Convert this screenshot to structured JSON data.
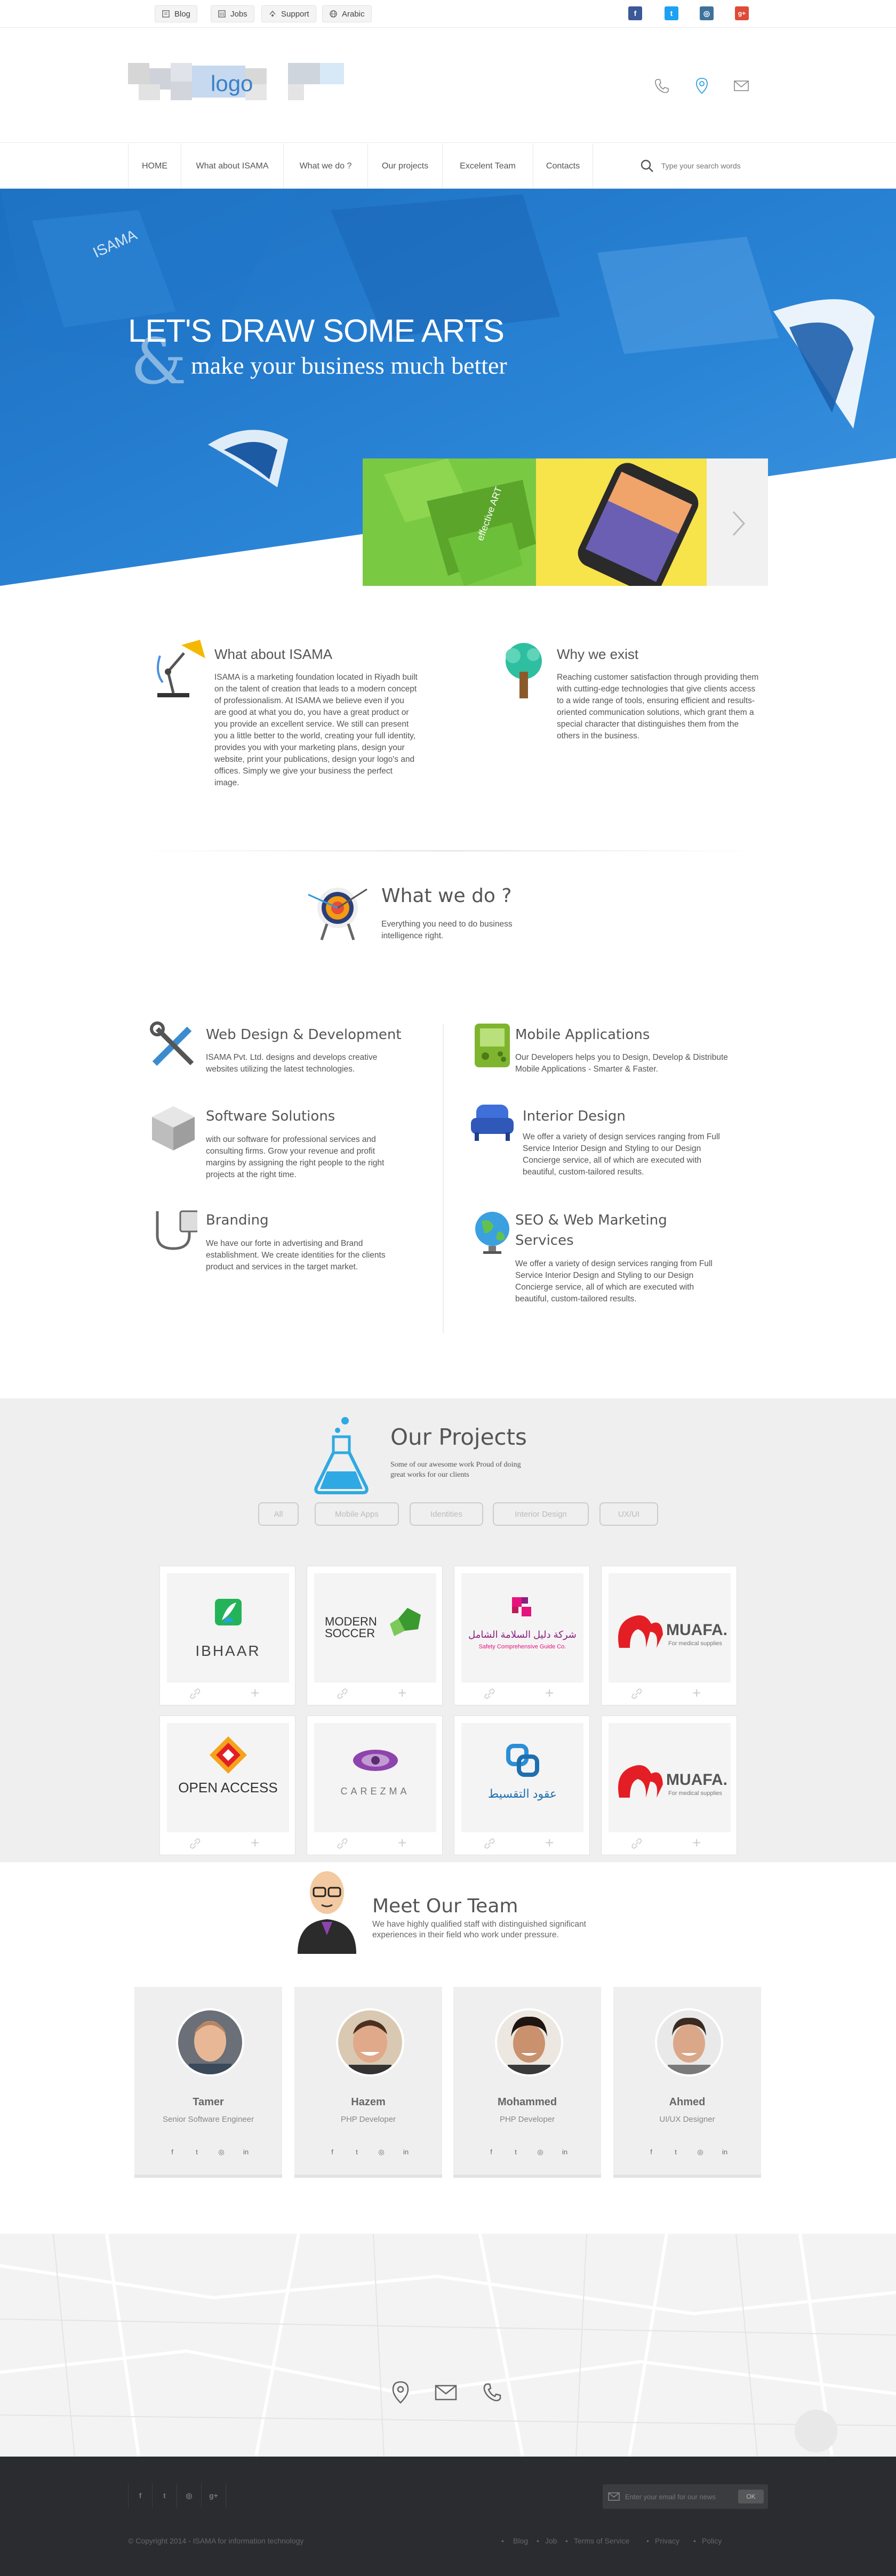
{
  "topbar": {
    "links": [
      {
        "label": "Blog",
        "icon": "blog-icon"
      },
      {
        "label": "Jobs",
        "icon": "jobs-icon"
      },
      {
        "label": "Support",
        "icon": "support-icon"
      },
      {
        "label": "Arabic",
        "icon": "globe-icon"
      }
    ],
    "social": [
      {
        "name": "facebook-icon",
        "glyph": "f",
        "color": "#3b5998"
      },
      {
        "name": "twitter-icon",
        "glyph": "t",
        "color": "#1da1f2"
      },
      {
        "name": "instagram-icon",
        "glyph": "◎",
        "color": "#3f729b"
      },
      {
        "name": "google-plus-icon",
        "glyph": "g+",
        "color": "#dd4b39"
      }
    ]
  },
  "header": {
    "logo_text": "logo",
    "icons": [
      "phone-icon",
      "location-pin-icon",
      "mail-icon"
    ]
  },
  "nav": {
    "items": [
      "HOME",
      "What about ISAMA",
      "What we do ?",
      "Our projects",
      "Excelent Team",
      "Contacts"
    ],
    "search_placeholder": "Type your search words"
  },
  "hero": {
    "title": "LET'S DRAW SOME ARTS",
    "amp": "&",
    "subtitle": "make your business much better",
    "slide_text": "effective ART",
    "accent": "#1e7ccc"
  },
  "about": {
    "left": {
      "title": "What about ISAMA",
      "text": "ISAMA is a marketing foundation located in Riyadh built on the talent of creation that leads to a modern concept of professionalism. At ISAMA we believe even if you are good at what you do, you have a great product or you provide an excellent service. We still can present you a little better to the world, creating your full identity, provides you with your marketing plans, design your website, print your publications, design your logo's and offices. Simply we give your business the perfect image."
    },
    "right": {
      "title": "Why we exist",
      "text": "Reaching customer satisfaction through providing them with cutting-edge technologies that give clients access to a wide range of tools, ensuring efficient and results-oriented communication solutions, which grant them a special character that distinguishes them from the others in the business."
    }
  },
  "whatwedo": {
    "title": "What we do ?",
    "subtitle": "Everything you need to do business intelligence right."
  },
  "services": {
    "left": [
      {
        "title": "Web Design & Development",
        "text": "ISAMA Pvt. Ltd. designs and develops creative websites utilizing the latest technologies."
      },
      {
        "title": "Software Solutions",
        "text": "with our software for professional services and consulting firms. Grow your revenue and profit margins by assigning the right people to the right projects at the right time."
      },
      {
        "title": "Branding",
        "text": "We have our forte in advertising and Brand establishment. We create identities for the clients product and services in the target market."
      }
    ],
    "right": [
      {
        "title": "Mobile Applications",
        "text": "Our Developers helps you to Design, Develop & Distribute Mobile Applications - Smarter & Faster."
      },
      {
        "title": "Interior Design",
        "text": "We offer a variety of design services ranging from Full Service Interior Design and Styling to our Design Concierge service, all of which are executed with beautiful, custom-tailored results."
      },
      {
        "title": "SEO & Web Marketing Services",
        "text": "We offer a variety of design services ranging from Full Service Interior Design and Styling to our Design Concierge service, all of which are executed with beautiful, custom-tailored results."
      }
    ]
  },
  "projects": {
    "title": "Our Projects",
    "subtitle": "Some of our awesome work Proud of doing great works for our clients",
    "filters": [
      "All",
      "Mobile Apps",
      "Identities",
      "Interior Design",
      "UX/UI"
    ],
    "items": [
      {
        "name": "IBHAAR"
      },
      {
        "name": "MODERN SOCCER"
      },
      {
        "name": "شركة دليل السلامة الشامل",
        "sub": "Safety Comprehensive Guide Co."
      },
      {
        "name": "MUAFA.",
        "sub": "For medical supplies"
      },
      {
        "name": "OPEN ACCESS"
      },
      {
        "name": "CAREZMA"
      },
      {
        "name": "عقود التقسيط"
      },
      {
        "name": "MUAFA.",
        "sub": "For medical supplies"
      }
    ]
  },
  "team": {
    "title": "Meet Our Team",
    "subtitle": "We have highly qualified staff with distinguished significant experiences in their field who work under pressure.",
    "members": [
      {
        "name": "Tamer",
        "role": "Senior Software Engineer"
      },
      {
        "name": "Hazem",
        "role": "PHP Developer"
      },
      {
        "name": "Mohammed",
        "role": "PHP Developer"
      },
      {
        "name": "Ahmed",
        "role": "UI/UX Designer"
      }
    ],
    "social_glyphs": [
      "f",
      "t",
      "◎",
      "in"
    ]
  },
  "footer": {
    "social": [
      "f",
      "t",
      "◎",
      "g+"
    ],
    "newsletter_placeholder": "Enter your email for our news",
    "newsletter_button": "OK",
    "copyright": "© Copyright 2014 - ISAMA for information technology",
    "links": [
      "Blog",
      "Job",
      "Terms of Service",
      "Privacy",
      "Policy"
    ]
  }
}
